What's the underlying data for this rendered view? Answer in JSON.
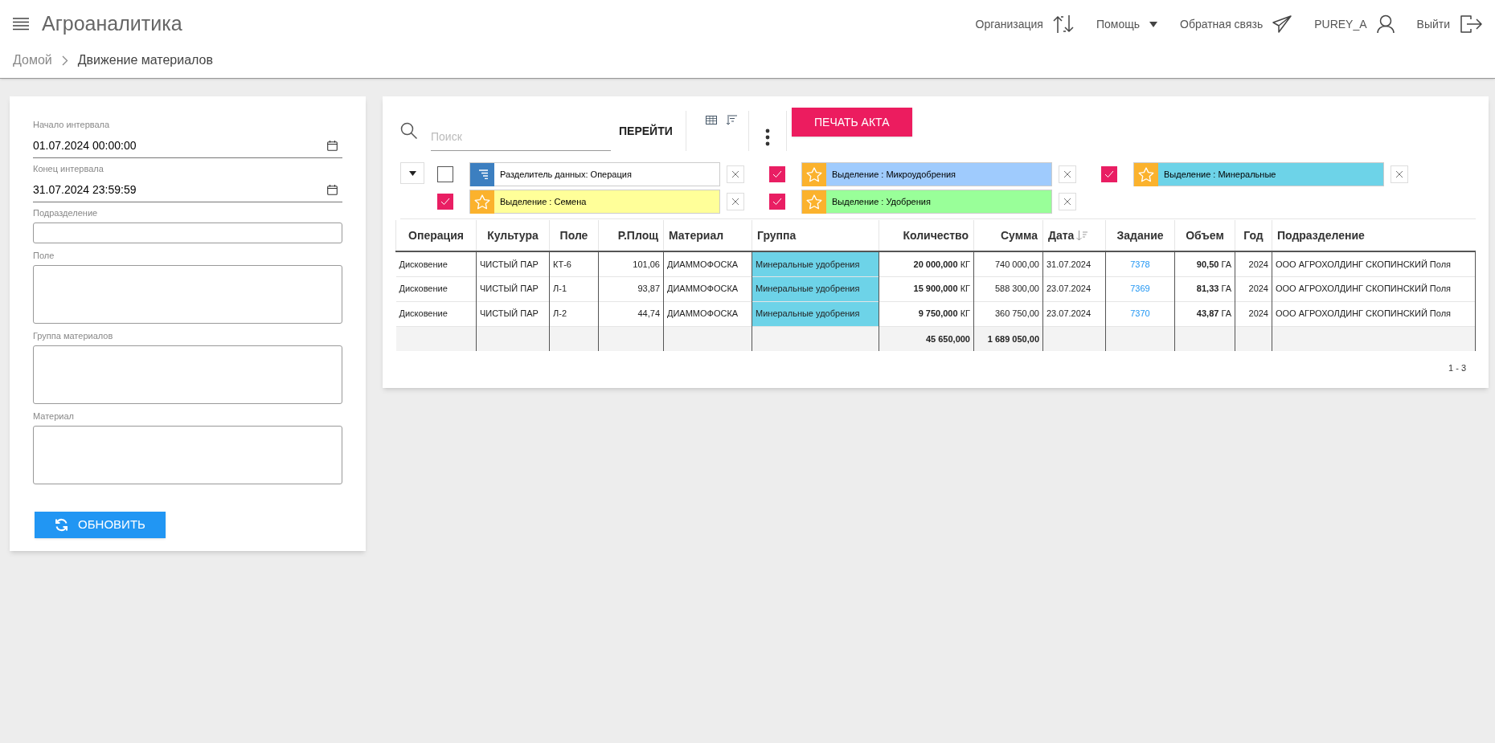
{
  "app": {
    "title": "Агроаналитика"
  },
  "nav": [
    {
      "label": "Организация",
      "kind": "swap"
    },
    {
      "label": "Помощь",
      "kind": "dropdown"
    },
    {
      "label": "Обратная связь",
      "kind": "send"
    },
    {
      "label": "PUREY_A",
      "kind": "user"
    },
    {
      "label": "Выйти",
      "kind": "logout"
    }
  ],
  "breadcrumb": [
    "Домой",
    "Движение материалов"
  ],
  "filters": [
    {
      "label": "Начало интервала",
      "kind": "date",
      "value": "01.07.2024 00:00:00"
    },
    {
      "label": "Конец интервала",
      "kind": "date",
      "value": "31.07.2024 23:59:59"
    },
    {
      "label": "Подразделение",
      "kind": "input"
    },
    {
      "label": "Поле",
      "kind": "textarea"
    },
    {
      "label": "Группа материалов",
      "kind": "textarea"
    },
    {
      "label": "Материал",
      "kind": "textarea"
    }
  ],
  "refresh_button": "ОБНОВИТЬ",
  "toolbar": {
    "search_placeholder": "Поиск",
    "go_button": "ПЕРЕЙТИ",
    "print_button": "ПЕЧАТЬ АКТА"
  },
  "rules": [
    {
      "label": "Разделитель данных: Операция",
      "kind": "separator",
      "checked": false
    },
    {
      "label": "Выделение : Микроудобрения",
      "kind": "highlight",
      "checked": true,
      "color": "#9fcbfd"
    },
    {
      "label": "Выделение : Минеральные",
      "kind": "highlight",
      "checked": true,
      "color": "#6dd3e8"
    },
    {
      "label": "Выделение : Семена",
      "kind": "highlight",
      "checked": true,
      "color": "#ffff99"
    },
    {
      "label": "Выделение : Удобрения",
      "kind": "highlight",
      "checked": true,
      "color": "#99ff99"
    }
  ],
  "table": {
    "columns": [
      {
        "label": "Операция"
      },
      {
        "label": "Культура"
      },
      {
        "label": "Поле"
      },
      {
        "label": "Р.Площ"
      },
      {
        "label": "Материал"
      },
      {
        "label": "Группа"
      },
      {
        "label": "Количество"
      },
      {
        "label": "Сумма"
      },
      {
        "label": "Дата",
        "sorted": true
      },
      {
        "label": "Задание"
      },
      {
        "label": "Объем"
      },
      {
        "label": "Год"
      },
      {
        "label": "Подразделение"
      }
    ],
    "rows": [
      {
        "color": "#6dd3e8",
        "cells": [
          "Дисковение",
          "ЧИСТЫЙ ПАР",
          "КТ-6",
          "101,06",
          "ДИАММОФОСКА",
          "Минеральные удобрения",
          "**20 000,000** КГ",
          "740 000,00",
          "31.07.2024",
          "7378",
          "**90,50** ГА",
          "2024",
          "ООО АГРОХОЛДИНГ СКОПИНСКИЙ Поля"
        ]
      },
      {
        "color": "#6dd3e8",
        "cells": [
          "Дисковение",
          "ЧИСТЫЙ ПАР",
          "Л-1",
          "93,87",
          "ДИАММОФОСКА",
          "Минеральные удобрения",
          "**15 900,000** КГ",
          "588 300,00",
          "23.07.2024",
          "7369",
          "**81,33** ГА",
          "2024",
          "ООО АГРОХОЛДИНГ СКОПИНСКИЙ Поля"
        ]
      },
      {
        "color": "#6dd3e8",
        "cells": [
          "Дисковение",
          "ЧИСТЫЙ ПАР",
          "Л-2",
          "44,74",
          "ДИАММОФОСКА",
          "Минеральные удобрения",
          "**9 750,000** КГ",
          "360 750,00",
          "23.07.2024",
          "7370",
          "**43,87** ГА",
          "2024",
          "ООО АГРОХОЛДИНГ СКОПИНСКИЙ Поля"
        ]
      }
    ],
    "totals": {
      "column_7": "45 650,000",
      "column_8": "1 689 050,00"
    },
    "pagination": "1 - 3"
  }
}
